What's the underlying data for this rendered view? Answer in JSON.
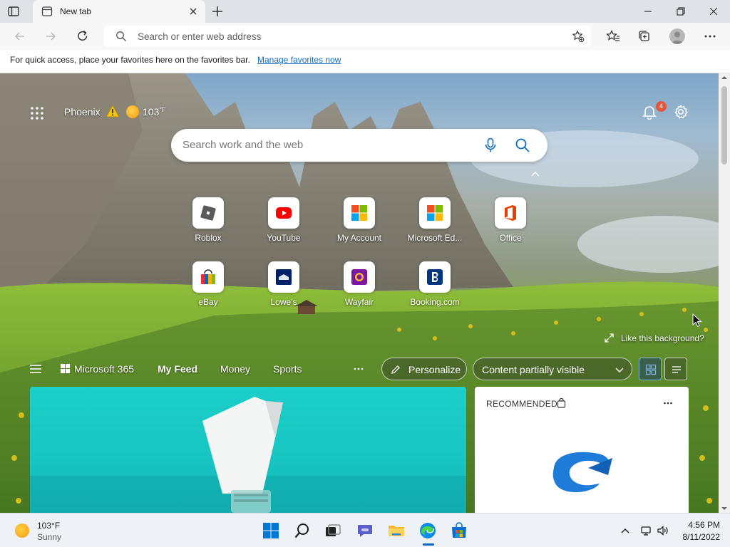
{
  "browser": {
    "tab_title": "New tab",
    "address_placeholder": "Search or enter web address"
  },
  "favorites_bar": {
    "message": "For quick access, place your favorites here on the favorites bar.",
    "link": "Manage favorites now"
  },
  "new_tab": {
    "location": "Phoenix",
    "temperature": "103",
    "temperature_unit": "°F",
    "notifications_count": "4",
    "search_placeholder": "Search work and the web",
    "quick_links": [
      {
        "label": "Roblox",
        "icon": "roblox-icon"
      },
      {
        "label": "YouTube",
        "icon": "youtube-icon"
      },
      {
        "label": "My Account",
        "icon": "microsoft-logo-icon"
      },
      {
        "label": "Microsoft Ed...",
        "icon": "microsoft-logo-icon"
      },
      {
        "label": "Office",
        "icon": "office-icon"
      },
      {
        "label": "eBay",
        "icon": "ebay-icon"
      },
      {
        "label": "Lowe's",
        "icon": "lowes-icon"
      },
      {
        "label": "Wayfair",
        "icon": "wayfair-icon"
      },
      {
        "label": "Booking.com",
        "icon": "booking-icon"
      }
    ],
    "like_background": "Like this background?"
  },
  "feed": {
    "brand": "Microsoft 365",
    "tabs": [
      "My Feed",
      "Money",
      "Sports"
    ],
    "active_tab": "My Feed",
    "personalize": "Personalize",
    "content_visibility": "Content partially visible",
    "recommended_title": "RECOMMENDED"
  },
  "taskbar": {
    "weather_temp": "103°F",
    "weather_condition": "Sunny",
    "time": "4:56 PM",
    "date": "8/11/2022"
  },
  "colors": {
    "accent": "#0067c0",
    "link": "#0f6cbd",
    "badge": "#e3553c"
  }
}
